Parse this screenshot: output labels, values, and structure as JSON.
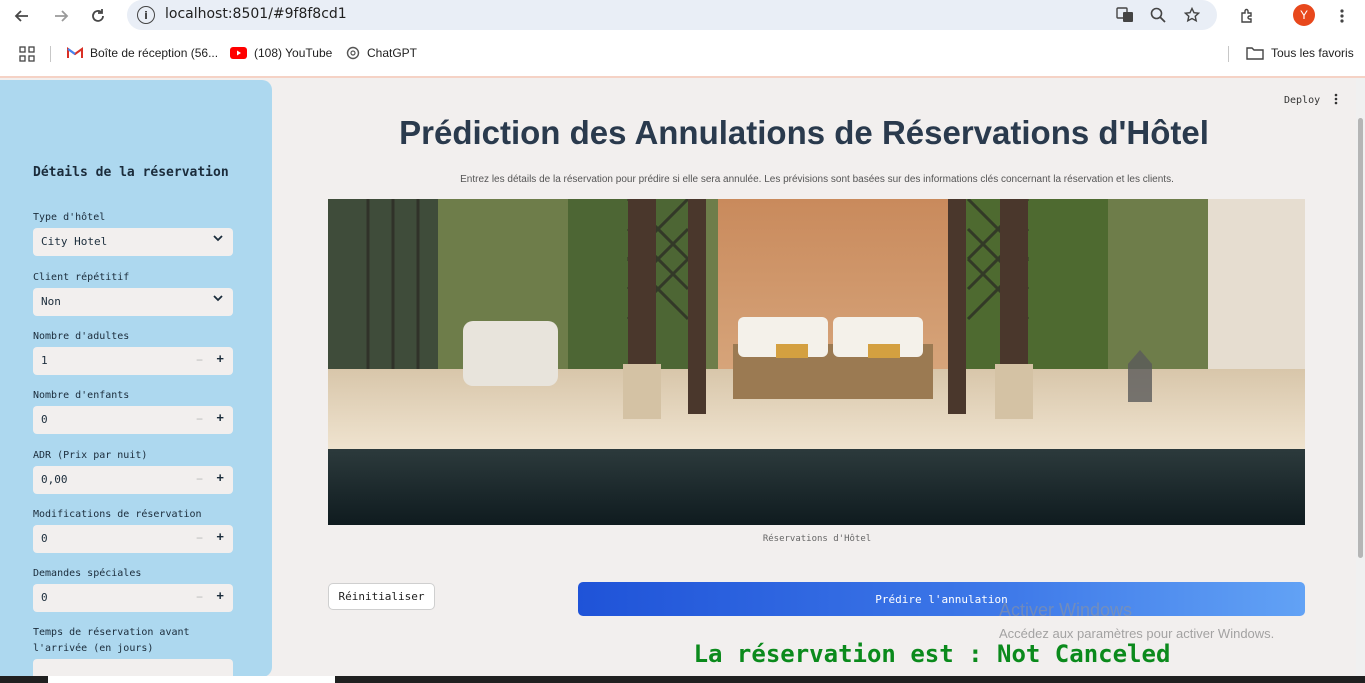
{
  "browser": {
    "url": "localhost:8501/#9f8f8cd1",
    "avatar_letter": "Y",
    "bookmarks": [
      {
        "label": "Boîte de réception (56...",
        "icon": "gmail-icon"
      },
      {
        "label": "(108) YouTube",
        "icon": "youtube-icon"
      },
      {
        "label": "ChatGPT",
        "icon": "chatgpt-icon"
      }
    ],
    "all_bookmarks_label": "Tous les favoris"
  },
  "app": {
    "deploy_label": "Deploy",
    "title": "Prédiction des Annulations de Réservations d'Hôtel",
    "subtitle": "Entrez les détails de la réservation pour prédire si elle sera annulée. Les prévisions sont basées sur des informations clés concernant la réservation et les clients.",
    "image_caption": "Réservations d'Hôtel",
    "reset_label": "Réinitialiser",
    "predict_label": "Prédire l'annulation",
    "result_text": "La réservation est : Not Canceled",
    "result_color": "#0b8a1c"
  },
  "sidebar": {
    "title": "Détails de la réservation",
    "fields": [
      {
        "label": "Type d'hôtel",
        "value": "City Hotel",
        "kind": "select"
      },
      {
        "label": "Client répétitif",
        "value": "Non",
        "kind": "select"
      },
      {
        "label": "Nombre d'adultes",
        "value": "1",
        "kind": "number"
      },
      {
        "label": "Nombre d'enfants",
        "value": "0",
        "kind": "number"
      },
      {
        "label": "ADR (Prix par nuit)",
        "value": "0,00",
        "kind": "number"
      },
      {
        "label": "Modifications de réservation",
        "value": "0",
        "kind": "number"
      },
      {
        "label": "Demandes spéciales",
        "value": "0",
        "kind": "number"
      },
      {
        "label": "Temps de réservation avant l'arrivée (en jours)",
        "value": "",
        "kind": "number"
      }
    ]
  },
  "watermark": {
    "line1": "Activer Windows",
    "line2": "Accédez aux paramètres pour activer Windows."
  }
}
